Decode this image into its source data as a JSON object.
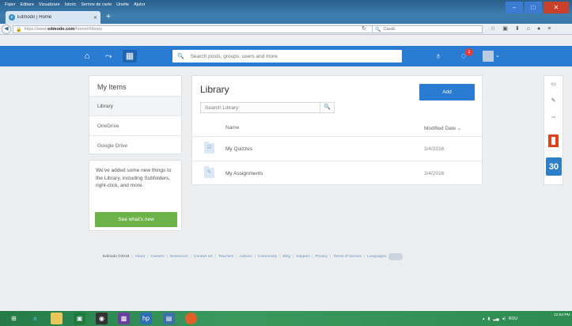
{
  "browser": {
    "menu": [
      "Fișier",
      "Editare",
      "Vizualizare",
      "Istoric",
      "Semne de carte",
      "Unelte",
      "Ajutor"
    ],
    "tab_title": "Edmodo | Home",
    "url_prefix": "https://www.",
    "url_domain": "edmodo.com",
    "url_path": "/home#/library",
    "search_placeholder": "Caută",
    "window_buttons": {
      "minimize": "–",
      "maximize": "□",
      "close": "✕"
    }
  },
  "edmodo": {
    "search_placeholder": "Search posts, groups, users and more",
    "notification_count": "1"
  },
  "my_items": {
    "title": "My Items",
    "items": [
      "Library",
      "OneDrive",
      "Google Drive"
    ],
    "active_index": 0
  },
  "promo": {
    "text": "We've added some new things to the Library, including Subfolders, right-click, and more.",
    "button": "See what's new"
  },
  "library": {
    "title": "Library",
    "add_button": "Add",
    "search_placeholder": "Search Library",
    "columns": {
      "name": "Name",
      "modified": "Modified Date ⌄"
    },
    "rows": [
      {
        "name": "My Quizzes",
        "date": "3/4/2016",
        "icon": "quiz-folder-icon"
      },
      {
        "name": "My Assignments",
        "date": "3/4/2016",
        "icon": "assignment-folder-icon"
      }
    ]
  },
  "right_rail": {
    "calendar_day": "30"
  },
  "footer": {
    "copyright": "Edmodo ©2016",
    "links": [
      "About",
      "Careers",
      "Newsroom",
      "Contact Us",
      "Teachers",
      "Admins",
      "Community",
      "Blog",
      "Support",
      "Privacy",
      "Terms of Service",
      "Languages"
    ]
  },
  "taskbar": {
    "language": "ROU",
    "time": "12:53 PM"
  },
  "colors": {
    "edmodo_blue": "#2a7cd3",
    "promo_green": "#6db34a",
    "taskbar_green": "#2e8c52"
  }
}
